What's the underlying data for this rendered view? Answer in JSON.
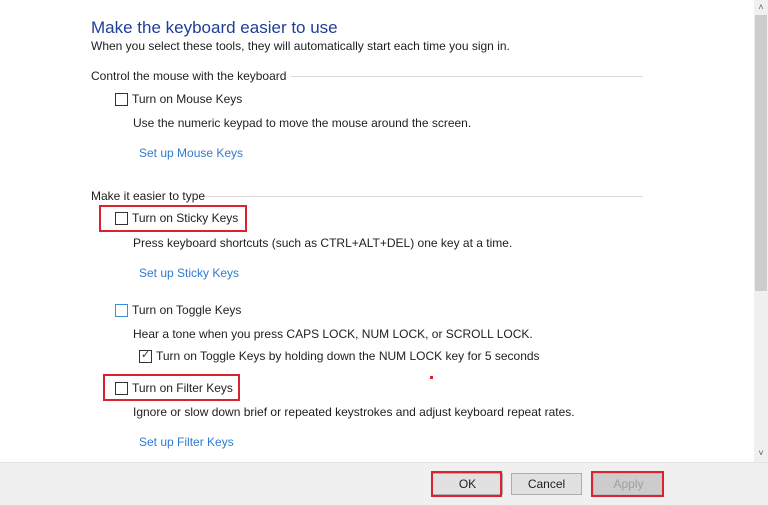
{
  "header": {
    "title": "Make the keyboard easier to use",
    "subtitle": "When you select these tools, they will automatically start each time you sign in."
  },
  "sections": {
    "mouse": {
      "heading": "Control the mouse with the keyboard",
      "mouse_keys": {
        "label": "Turn on Mouse Keys",
        "checked": false,
        "description": "Use the numeric keypad to move the mouse around the screen.",
        "link": "Set up Mouse Keys"
      }
    },
    "typing": {
      "heading": "Make it easier to type",
      "sticky_keys": {
        "label": "Turn on Sticky Keys",
        "checked": false,
        "description": "Press keyboard shortcuts (such as CTRL+ALT+DEL) one key at a time.",
        "link": "Set up Sticky Keys"
      },
      "toggle_keys": {
        "label": "Turn on Toggle Keys",
        "checked": false,
        "description": "Hear a tone when you press CAPS LOCK, NUM LOCK, or SCROLL LOCK.",
        "sub_option": {
          "label": "Turn on Toggle Keys by holding down the NUM LOCK key for 5 seconds",
          "checked": true
        }
      },
      "filter_keys": {
        "label": "Turn on Filter Keys",
        "checked": false,
        "description": "Ignore or slow down brief or repeated keystrokes and adjust keyboard repeat rates.",
        "link": "Set up Filter Keys"
      }
    }
  },
  "icons": {
    "scroll_up": "˄",
    "scroll_down": "˅",
    "check": "✓"
  },
  "footer": {
    "ok_label": "OK",
    "cancel_label": "Cancel",
    "apply_label": "Apply",
    "apply_enabled": false
  },
  "colors": {
    "title": "#1e3f99",
    "link": "#2e7bd0",
    "highlight": "#d9232e"
  }
}
